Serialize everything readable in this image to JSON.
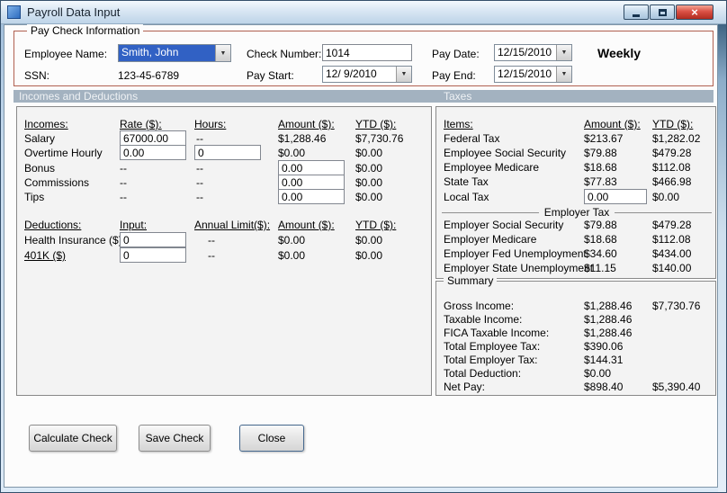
{
  "window": {
    "title": "Payroll Data Input"
  },
  "icons": {
    "dropdown_arrow": "▼",
    "close": "×"
  },
  "paycheck": {
    "group_title": "Pay Check Information",
    "employee_name_label": "Employee Name:",
    "employee_name_value": "Smith, John",
    "ssn_label": "SSN:",
    "ssn_value": "123-45-6789",
    "check_number_label": "Check Number:",
    "check_number_value": "1014",
    "pay_start_label": "Pay Start:",
    "pay_start_value": "12/ 9/2010",
    "pay_date_label": "Pay Date:",
    "pay_date_value": "12/15/2010",
    "pay_end_label": "Pay End:",
    "pay_end_value": "12/15/2010",
    "frequency": "Weekly"
  },
  "section_bar": {
    "left": "Incomes and Deductions",
    "right": "Taxes"
  },
  "incomes": {
    "headers": {
      "name": "Incomes:",
      "rate": "Rate ($):",
      "hours": "Hours:",
      "amount": "Amount ($):",
      "ytd": "YTD ($):"
    },
    "rows": [
      {
        "name": "Salary",
        "rate": "67000.00",
        "hours": "--",
        "amount": "$1,288.46",
        "ytd": "$7,730.76"
      },
      {
        "name": "Overtime Hourly",
        "rate": "0.00",
        "hours": "0",
        "amount": "$0.00",
        "ytd": "$0.00"
      },
      {
        "name": "Bonus",
        "rate": "--",
        "hours": "--",
        "amount": "0.00",
        "ytd": "$0.00"
      },
      {
        "name": "Commissions",
        "rate": "--",
        "hours": "--",
        "amount": "0.00",
        "ytd": "$0.00"
      },
      {
        "name": "Tips",
        "rate": "--",
        "hours": "--",
        "amount": "0.00",
        "ytd": "$0.00"
      }
    ]
  },
  "deductions": {
    "headers": {
      "name": "Deductions:",
      "input": "Input:",
      "annual_limit": "Annual Limit($):",
      "amount": "Amount ($):",
      "ytd": "YTD ($):"
    },
    "rows": [
      {
        "name": "Health Insurance  ($)",
        "input": "0",
        "annual_limit": "--",
        "amount": "$0.00",
        "ytd": "$0.00"
      },
      {
        "name": "401K  ($)",
        "input": "0",
        "annual_limit": "--",
        "amount": "$0.00",
        "ytd": "$0.00"
      }
    ]
  },
  "taxes": {
    "headers": {
      "item": "Items:",
      "amount": "Amount ($):",
      "ytd": "YTD ($):"
    },
    "employee_rows": [
      {
        "item": "Federal Tax",
        "amount": "$213.67",
        "ytd": "$1,282.02"
      },
      {
        "item": "Employee Social Security",
        "amount": "$79.88",
        "ytd": "$479.28"
      },
      {
        "item": "Employee Medicare",
        "amount": "$18.68",
        "ytd": "$112.08"
      },
      {
        "item": "State Tax",
        "amount": "$77.83",
        "ytd": "$466.98"
      },
      {
        "item": "Local Tax",
        "amount": "0.00",
        "ytd": "$0.00"
      }
    ],
    "employer_divider": "Employer Tax",
    "employer_rows": [
      {
        "item": "Employer Social Security",
        "amount": "$79.88",
        "ytd": "$479.28"
      },
      {
        "item": "Employer Medicare",
        "amount": "$18.68",
        "ytd": "$112.08"
      },
      {
        "item": "Employer Fed Unemployment",
        "amount": "$34.60",
        "ytd": "$434.00"
      },
      {
        "item": "Employer State Unemployment",
        "amount": "$11.15",
        "ytd": "$140.00"
      }
    ]
  },
  "summary": {
    "group_title": "Summary",
    "rows": [
      {
        "label": "Gross Income:",
        "amount": "$1,288.46",
        "ytd": "$7,730.76"
      },
      {
        "label": "Taxable Income:",
        "amount": "$1,288.46",
        "ytd": ""
      },
      {
        "label": "FICA Taxable Income:",
        "amount": "$1,288.46",
        "ytd": ""
      },
      {
        "label": "Total Employee Tax:",
        "amount": "$390.06",
        "ytd": ""
      },
      {
        "label": "Total Employer Tax:",
        "amount": "$144.31",
        "ytd": ""
      },
      {
        "label": "Total Deduction:",
        "amount": "$0.00",
        "ytd": ""
      },
      {
        "label": "Net Pay:",
        "amount": "$898.40",
        "ytd": "$5,390.40"
      }
    ]
  },
  "buttons": {
    "calculate": "Calculate Check",
    "save": "Save Check",
    "close": "Close"
  }
}
